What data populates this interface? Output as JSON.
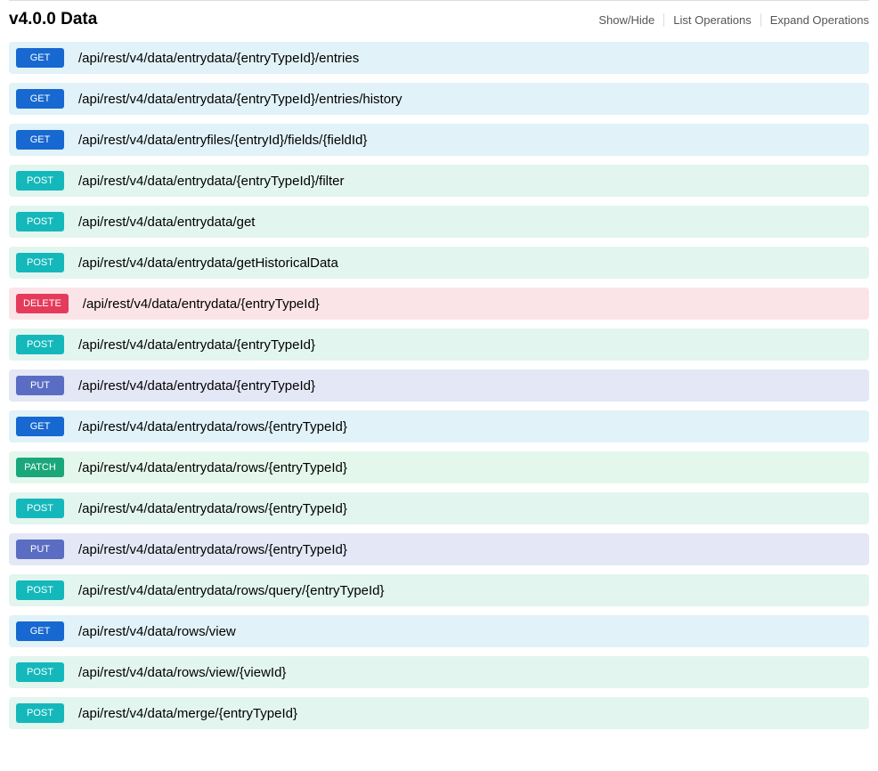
{
  "section": {
    "title": "v4.0.0 Data",
    "actions": {
      "showHide": "Show/Hide",
      "listOps": "List Operations",
      "expandOps": "Expand Operations"
    }
  },
  "operations": [
    {
      "method": "GET",
      "path": "/api/rest/v4/data/entrydata/{entryTypeId}/entries"
    },
    {
      "method": "GET",
      "path": "/api/rest/v4/data/entrydata/{entryTypeId}/entries/history"
    },
    {
      "method": "GET",
      "path": "/api/rest/v4/data/entryfiles/{entryId}/fields/{fieldId}"
    },
    {
      "method": "POST",
      "path": "/api/rest/v4/data/entrydata/{entryTypeId}/filter"
    },
    {
      "method": "POST",
      "path": "/api/rest/v4/data/entrydata/get"
    },
    {
      "method": "POST",
      "path": "/api/rest/v4/data/entrydata/getHistoricalData"
    },
    {
      "method": "DELETE",
      "path": "/api/rest/v4/data/entrydata/{entryTypeId}"
    },
    {
      "method": "POST",
      "path": "/api/rest/v4/data/entrydata/{entryTypeId}"
    },
    {
      "method": "PUT",
      "path": "/api/rest/v4/data/entrydata/{entryTypeId}"
    },
    {
      "method": "GET",
      "path": "/api/rest/v4/data/entrydata/rows/{entryTypeId}"
    },
    {
      "method": "PATCH",
      "path": "/api/rest/v4/data/entrydata/rows/{entryTypeId}"
    },
    {
      "method": "POST",
      "path": "/api/rest/v4/data/entrydata/rows/{entryTypeId}"
    },
    {
      "method": "PUT",
      "path": "/api/rest/v4/data/entrydata/rows/{entryTypeId}"
    },
    {
      "method": "POST",
      "path": "/api/rest/v4/data/entrydata/rows/query/{entryTypeId}"
    },
    {
      "method": "GET",
      "path": "/api/rest/v4/data/rows/view"
    },
    {
      "method": "POST",
      "path": "/api/rest/v4/data/rows/view/{viewId}"
    },
    {
      "method": "POST",
      "path": "/api/rest/v4/data/merge/{entryTypeId}"
    }
  ]
}
